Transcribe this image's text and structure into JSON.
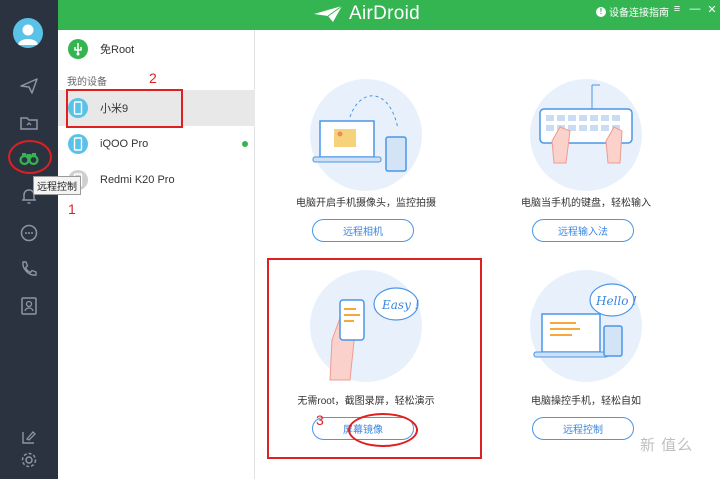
{
  "app": {
    "logo_text": "AirDroid",
    "guide_link": "设备连接指南"
  },
  "rail": {
    "tooltip": "远程控制"
  },
  "devices": {
    "top_item": "免Root",
    "section_label": "我的设备",
    "items": [
      {
        "name": "小米9",
        "selected": true
      },
      {
        "name": "iQOO Pro",
        "online": true
      },
      {
        "name": "Redmi K20 Pro"
      }
    ]
  },
  "features": [
    {
      "desc": "电脑开启手机摄像头，监控拍摄",
      "button": "远程相机"
    },
    {
      "desc": "电脑当手机的键盘，轻松输入",
      "button": "远程输入法"
    },
    {
      "desc": "无需root，截图录屏，轻松演示",
      "button": "屏幕镜像",
      "bubble": "Easy !"
    },
    {
      "desc": "电脑操控手机，轻松自如",
      "button": "远程控制",
      "bubble": "Hello !"
    }
  ],
  "annotations": {
    "n1": "1",
    "n2": "2",
    "n3": "3"
  },
  "watermark": "新 值么"
}
